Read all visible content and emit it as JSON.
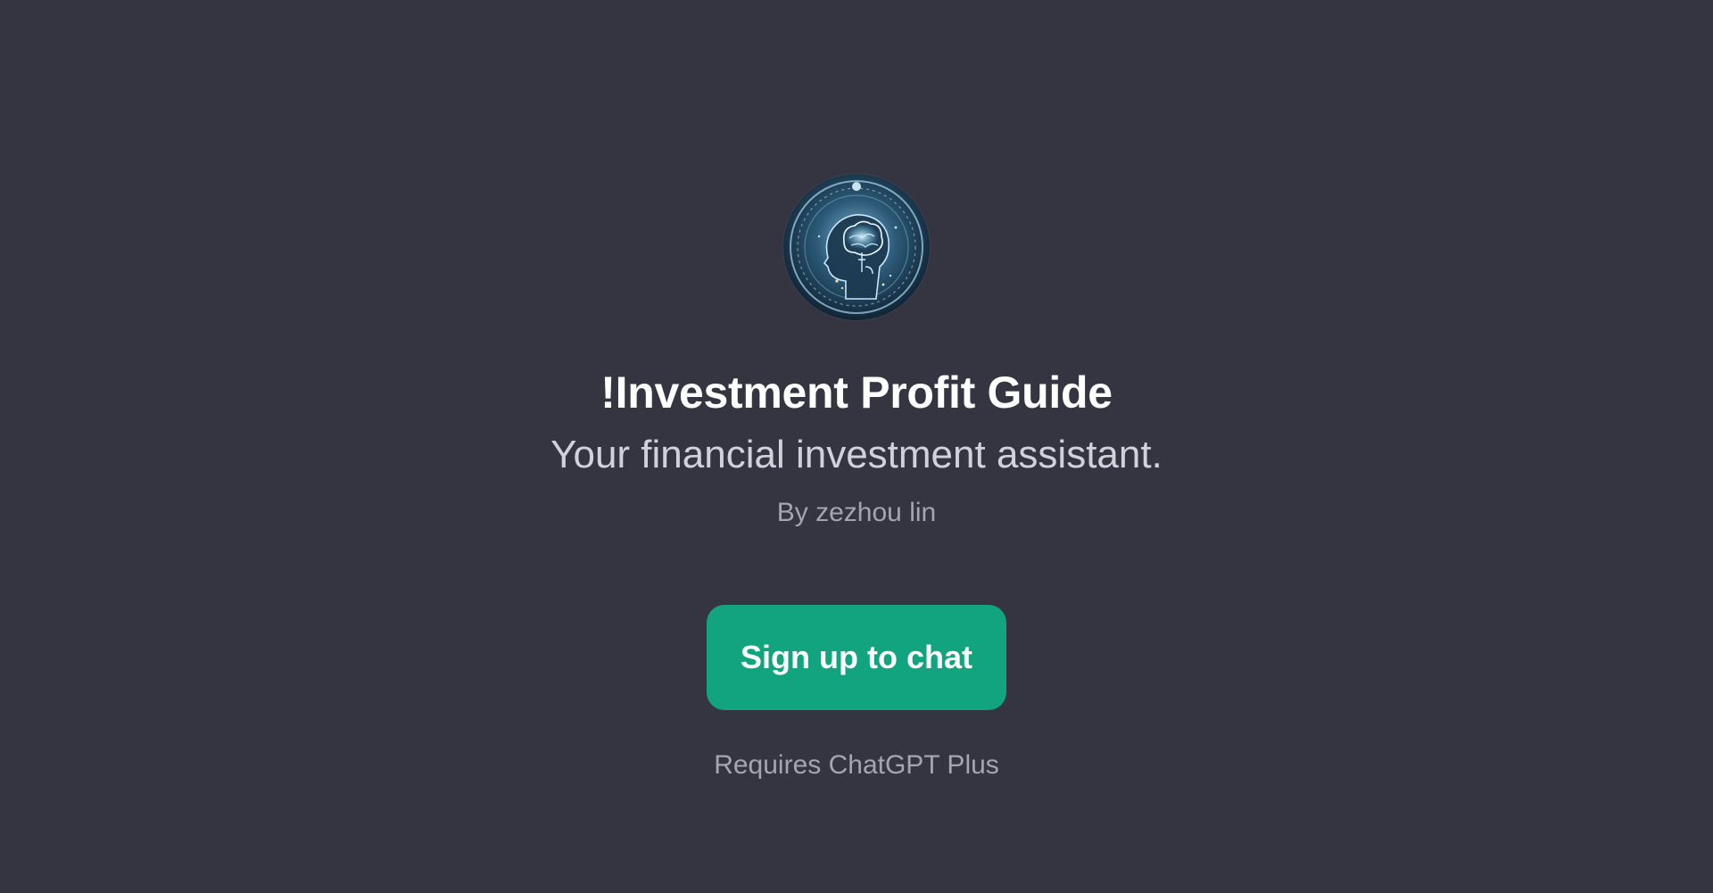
{
  "gpt": {
    "avatar_icon": "ai-brain-head-icon",
    "title": "!Investment Profit Guide",
    "description": "Your financial investment assistant.",
    "author": "By zezhou lin"
  },
  "actions": {
    "signup_label": "Sign up to chat",
    "signup_color": "#12a37f"
  },
  "footer": {
    "requirement": "Requires ChatGPT Plus"
  },
  "theme": {
    "background": "#343541"
  }
}
